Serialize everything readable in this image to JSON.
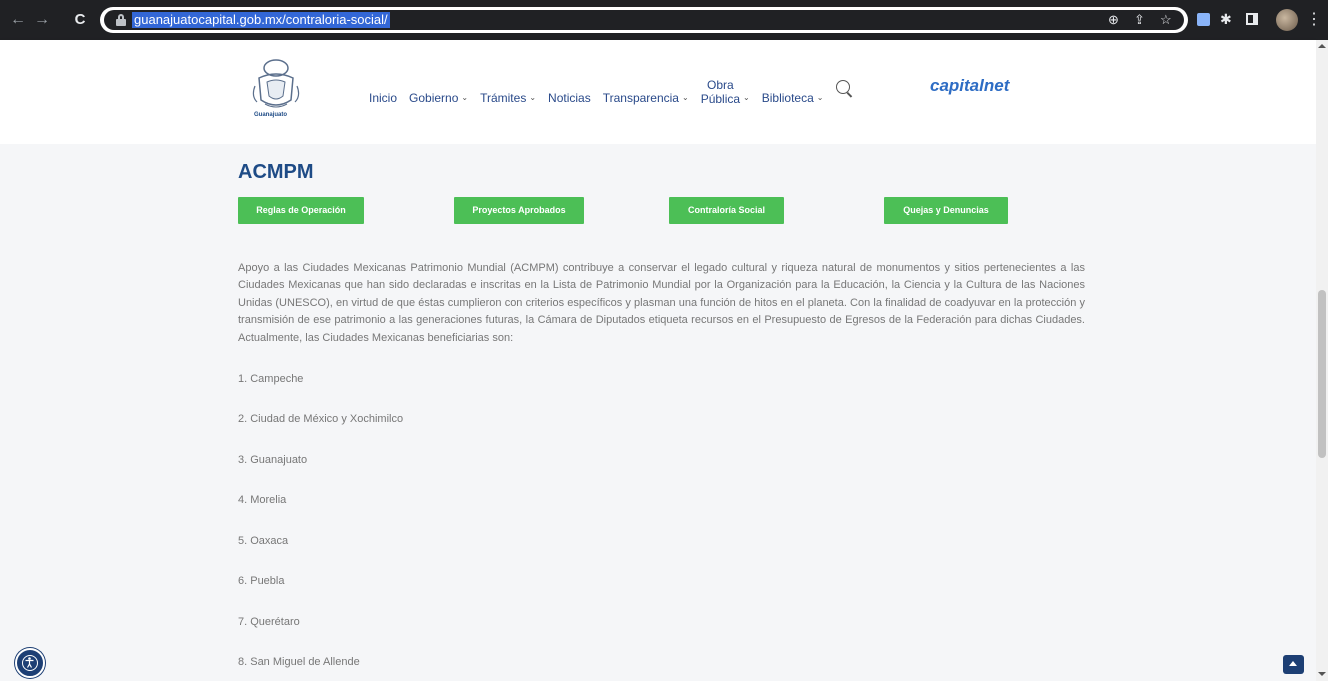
{
  "browser": {
    "url": "guanajuatocapital.gob.mx/contraloria-social/",
    "icons": [
      "back-arrow-icon",
      "forward-arrow-icon",
      "reload-icon",
      "lock-icon",
      "zoom-icon",
      "share-icon",
      "star-icon",
      "extension-icon",
      "puzzle-icon",
      "side-panel-icon",
      "profile-avatar",
      "menu-dots-icon"
    ],
    "back": "←",
    "forward": "→",
    "reload": "C",
    "zoom": "⊕",
    "share": "⇪",
    "star": "☆",
    "puzzle": "✱",
    "menu": "⋮"
  },
  "header": {
    "logo_text": "Guanajuato",
    "nav": {
      "inicio": "Inicio",
      "gobierno": "Gobierno",
      "tramites": "Trámites",
      "noticias": "Noticias",
      "transparencia": "Transparencia",
      "obra_line1": "Obra",
      "obra_line2": "Pública",
      "biblioteca": "Biblioteca"
    },
    "chevron": "⌄",
    "brand_capital": "capital",
    "brand_net": "net"
  },
  "main": {
    "title": "ACMPM",
    "buttons": {
      "reglas": "Reglas de Operación",
      "proyectos": "Proyectos Aprobados",
      "contraloria": "Contraloría Social",
      "quejas": "Quejas y Denuncias"
    },
    "paragraph": "Apoyo a las Ciudades Mexicanas Patrimonio Mundial (ACMPM) contribuye a conservar el legado cultural y riqueza natural de monumentos y sitios pertenecientes a las Ciudades Mexicanas que han sido declaradas e inscritas en la Lista de Patrimonio Mundial por la Organización para la Educación, la Ciencia y la Cultura de las Naciones Unidas (UNESCO), en virtud de que éstas cumplieron con criterios específicos y plasman una función de hitos en el planeta. Con la finalidad de coadyuvar en la protección y transmisión de ese patrimonio a las generaciones futuras, la Cámara de Diputados etiqueta recursos en el Presupuesto de Egresos de la Federación para dichas Ciudades. Actualmente, las Ciudades Mexicanas beneficiarias son:",
    "cities": [
      "1. Campeche",
      "2. Ciudad de México y Xochimilco",
      "3. Guanajuato",
      "4. Morelia",
      "5. Oaxaca",
      "6. Puebla",
      "7. Querétaro",
      "8. San Miguel de Allende"
    ]
  },
  "colors": {
    "accent_green": "#4cbf56",
    "title_blue": "#1e4b86",
    "nav_blue": "#2a4a8a"
  }
}
